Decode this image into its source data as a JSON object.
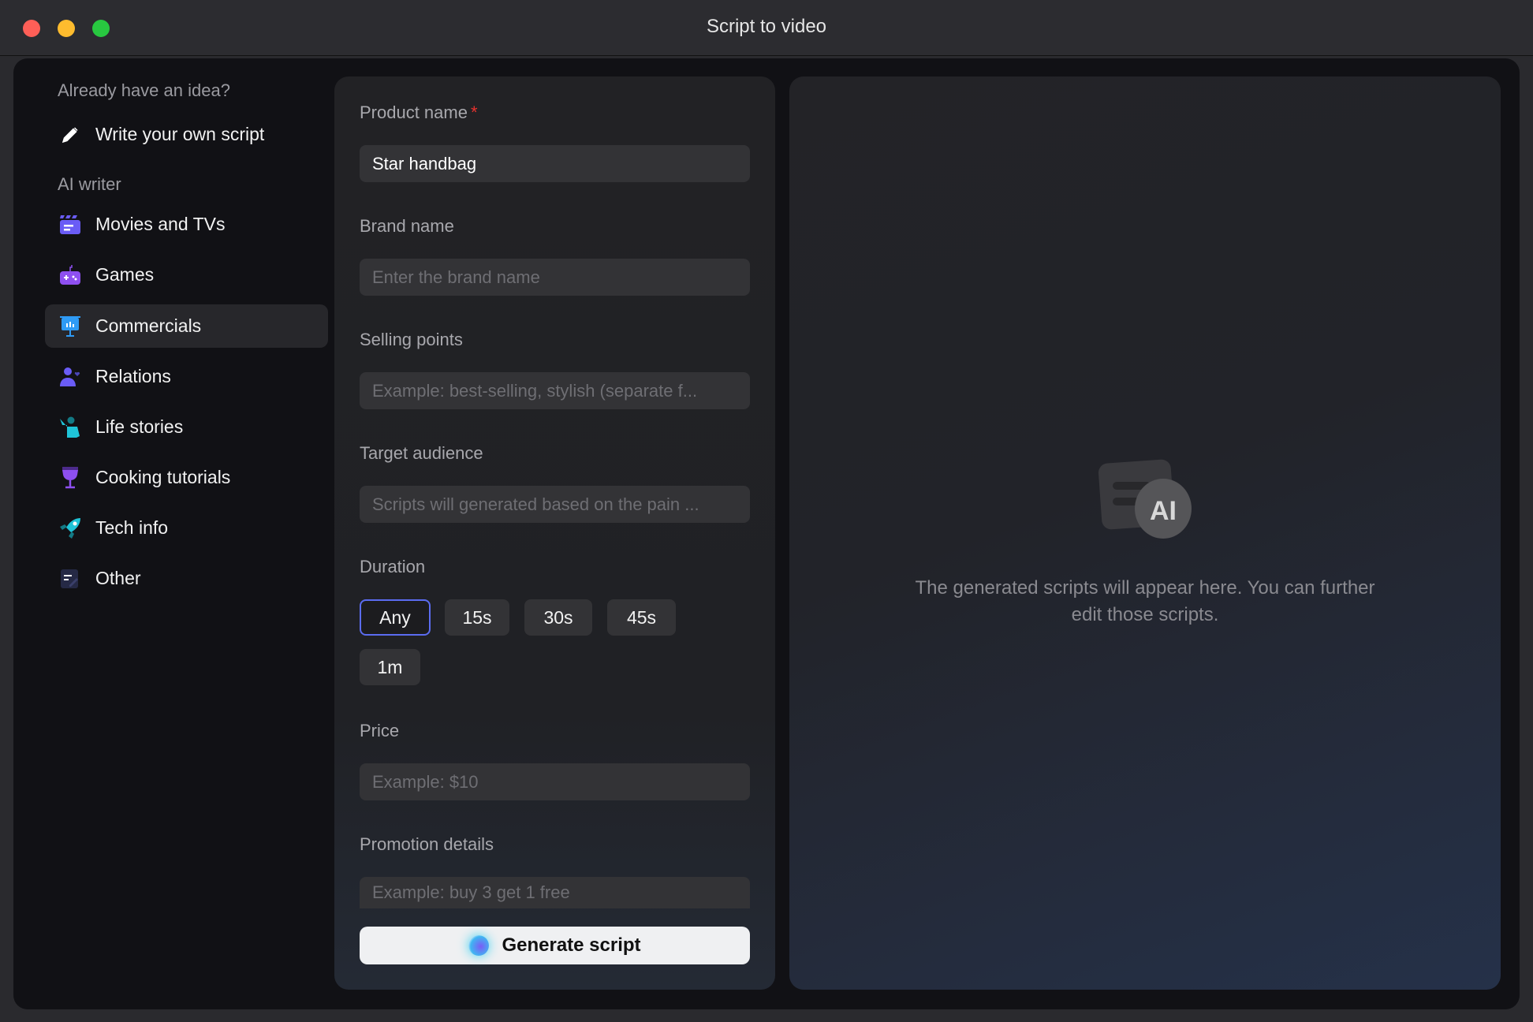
{
  "window": {
    "title": "Script to video",
    "controls": {
      "close": "#fe5f57",
      "minimize": "#febc2e",
      "maximize": "#28c840"
    }
  },
  "sidebar": {
    "heading_idea": "Already have an idea?",
    "write_own": {
      "label": "Write your own script",
      "icon": "pencil-icon"
    },
    "heading_ai": "AI writer",
    "items": [
      {
        "label": "Movies and TVs",
        "icon": "clapperboard-icon",
        "color": "#6a5cf6"
      },
      {
        "label": "Games",
        "icon": "gamepad-icon",
        "color": "#8e4ff0"
      },
      {
        "label": "Commercials",
        "icon": "presentation-chart-icon",
        "color": "#2f9bf5",
        "active": true
      },
      {
        "label": "Relations",
        "icon": "person-heart-icon",
        "color": "#6a5cf6"
      },
      {
        "label": "Life stories",
        "icon": "person-waving-icon",
        "color": "#1fc4d8"
      },
      {
        "label": "Cooking tutorials",
        "icon": "wine-glass-icon",
        "color": "#8e4ff0"
      },
      {
        "label": "Tech info",
        "icon": "rocket-icon",
        "color": "#1fc4d8"
      },
      {
        "label": "Other",
        "icon": "note-edit-icon",
        "color": "#3a3f6a"
      }
    ]
  },
  "form": {
    "product_name": {
      "label": "Product name",
      "required_mark": "*",
      "value": "Star handbag"
    },
    "brand_name": {
      "label": "Brand name",
      "placeholder": "Enter the brand name"
    },
    "selling_points": {
      "label": "Selling points",
      "placeholder": "Example: best-selling, stylish (separate f..."
    },
    "target_audience": {
      "label": "Target audience",
      "placeholder": "Scripts will generated based on the pain ..."
    },
    "duration": {
      "label": "Duration",
      "options": [
        "Any",
        "15s",
        "30s",
        "45s",
        "1m"
      ],
      "selected": "Any"
    },
    "price": {
      "label": "Price",
      "placeholder": "Example: $10"
    },
    "promotion": {
      "label": "Promotion details",
      "placeholder": "Example: buy 3 get 1 free"
    },
    "generate_label": "Generate script"
  },
  "preview": {
    "icon": "ai-script-icon",
    "icon_text": "AI",
    "empty_line1": "The generated scripts will appear here. You can further",
    "empty_line2": "edit those scripts."
  }
}
